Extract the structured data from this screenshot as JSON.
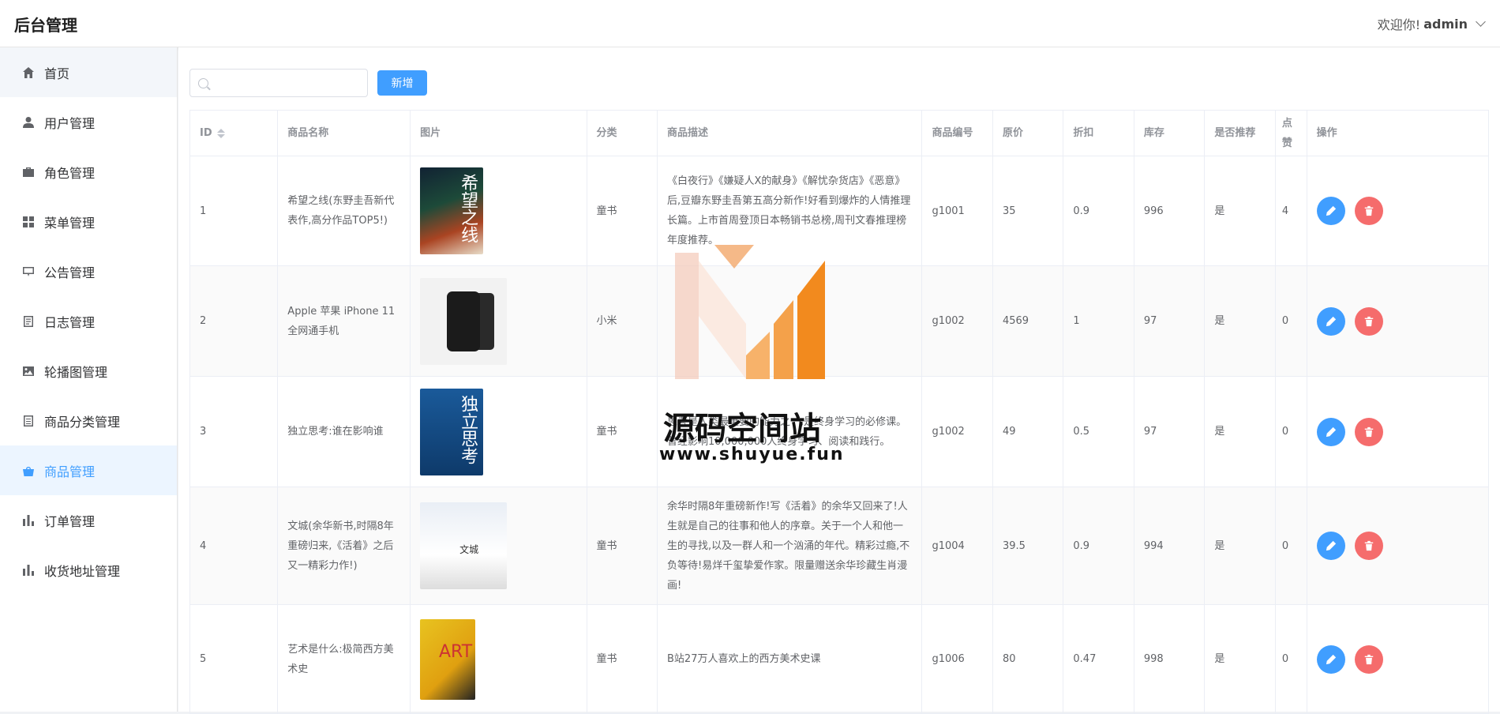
{
  "header": {
    "title": "后台管理",
    "welcome": "欢迎你!",
    "username": "admin"
  },
  "sidebar": {
    "items": [
      {
        "label": "首页",
        "icon": "home-icon"
      },
      {
        "label": "用户管理",
        "icon": "user-icon"
      },
      {
        "label": "角色管理",
        "icon": "briefcase-icon"
      },
      {
        "label": "菜单管理",
        "icon": "grid-icon"
      },
      {
        "label": "公告管理",
        "icon": "notice-icon"
      },
      {
        "label": "日志管理",
        "icon": "log-icon"
      },
      {
        "label": "轮播图管理",
        "icon": "picture-icon"
      },
      {
        "label": "商品分类管理",
        "icon": "document-icon"
      },
      {
        "label": "商品管理",
        "icon": "goods-icon"
      },
      {
        "label": "订单管理",
        "icon": "bar-chart-icon"
      },
      {
        "label": "收货地址管理",
        "icon": "bar-chart-icon"
      }
    ],
    "active_index": 8
  },
  "toolbar": {
    "search_placeholder": "",
    "search_value": "",
    "add_label": "新增"
  },
  "table": {
    "columns": [
      "ID",
      "商品名称",
      "图片",
      "分类",
      "商品描述",
      "商品编号",
      "原价",
      "折扣",
      "库存",
      "是否推荐",
      "点赞",
      "操作"
    ],
    "rows": [
      {
        "id": "1",
        "name": "希望之线(东野圭吾新代表作,高分作品TOP5!)",
        "image_title": "希望之线",
        "category": "童书",
        "description": "《白夜行》《嫌疑人X的献身》《解忧杂货店》《恶意》后,豆瓣东野圭吾第五高分新作!好看到爆炸的人情推理长篇。上市首周登顶日本畅销书总榜,周刊文春推理榜年度推荐。",
        "code": "g1001",
        "price": "35",
        "discount": "0.9",
        "stock": "996",
        "recommended": "是",
        "likes": "4"
      },
      {
        "id": "2",
        "name": "Apple 苹果 iPhone 11 全网通手机",
        "image_title": "",
        "category": "小米",
        "description": "",
        "code": "g1002",
        "price": "4569",
        "discount": "1",
        "stock": "97",
        "recommended": "是",
        "likes": "0"
      },
      {
        "id": "3",
        "name": "独立思考:谁在影响谁",
        "image_title": "独立思考",
        "category": "童书",
        "description": "思考是人类最重要的能力之一,是终身学习的必修课。曾经影响10,000,000人终身学习、阅读和践行。",
        "code": "g1002",
        "price": "49",
        "discount": "0.5",
        "stock": "97",
        "recommended": "是",
        "likes": "0"
      },
      {
        "id": "4",
        "name": "文城(余华新书,时隔8年重磅归来,《活着》之后又一精彩力作!)",
        "image_title": "文城",
        "category": "童书",
        "description": "余华时隔8年重磅新作!写《活着》的余华又回来了!人生就是自己的往事和他人的序章。关于一个人和他一生的寻找,以及一群人和一个汹涌的年代。精彩过瘾,不负等待!易烊千玺挚爱作家。限量赠送余华珍藏生肖漫画!",
        "code": "g1004",
        "price": "39.5",
        "discount": "0.9",
        "stock": "994",
        "recommended": "是",
        "likes": "0"
      },
      {
        "id": "5",
        "name": "艺术是什么:极简西方美术史",
        "image_title": "ART",
        "category": "童书",
        "description": "B站27万人喜欢上的西方美术史课",
        "code": "g1006",
        "price": "80",
        "discount": "0.47",
        "stock": "998",
        "recommended": "是",
        "likes": "0"
      }
    ]
  },
  "watermark": {
    "text": "源码空间站",
    "url": "www.shuyue.fun"
  },
  "colors": {
    "primary": "#409eff",
    "danger": "#f56c6c",
    "watermark_orange": "#f39a2e"
  }
}
